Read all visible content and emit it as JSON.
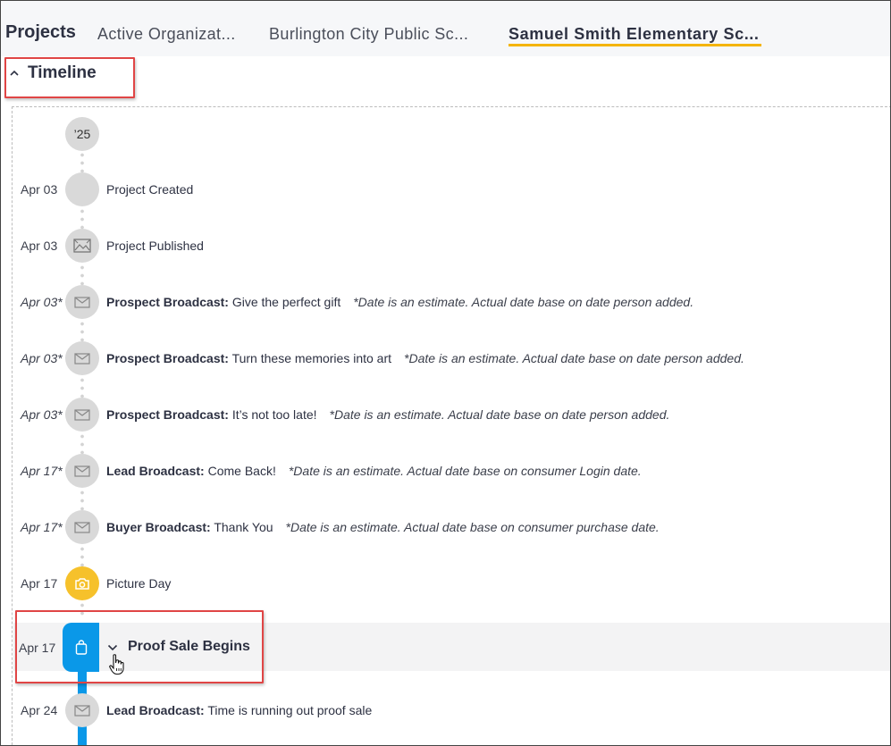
{
  "breadcrumb": {
    "root": "Projects",
    "items": [
      "Active Organizat...",
      "Burlington City Public Sc...",
      "Samuel Smith Elementary Sc..."
    ]
  },
  "section": {
    "title": "Timeline"
  },
  "timeline": {
    "year_label": "’25",
    "events": [
      {
        "date": "Apr 03",
        "kind": "",
        "text": "Project Created",
        "note": "",
        "icon": "blank"
      },
      {
        "date": "Apr 03",
        "kind": "",
        "text": "Project Published",
        "note": "",
        "icon": "image-icon"
      },
      {
        "date": "Apr 03*",
        "kind": "Prospect Broadcast:",
        "text": "Give the perfect gift",
        "note": "*Date is an estimate. Actual date base on date person added.",
        "icon": "envelope-icon"
      },
      {
        "date": "Apr 03*",
        "kind": "Prospect Broadcast:",
        "text": "Turn these memories into art",
        "note": "*Date is an estimate. Actual date base on date person added.",
        "icon": "envelope-icon"
      },
      {
        "date": "Apr 03*",
        "kind": "Prospect Broadcast:",
        "text": "It’s not too late!",
        "note": "*Date is an estimate. Actual date base on date person added.",
        "icon": "envelope-icon"
      },
      {
        "date": "Apr 17*",
        "kind": "Lead Broadcast:",
        "text": "Come Back!",
        "note": "*Date is an estimate. Actual date base on consumer Login date.",
        "icon": "envelope-icon"
      },
      {
        "date": "Apr 17*",
        "kind": "Buyer Broadcast:",
        "text": "Thank You",
        "note": "*Date is an estimate. Actual date base on consumer purchase date.",
        "icon": "envelope-icon"
      },
      {
        "date": "Apr 17",
        "kind": "",
        "text": "Picture Day",
        "note": "",
        "icon": "camera-icon"
      }
    ],
    "proof_sale": {
      "date": "Apr 17",
      "label": "Proof Sale Begins"
    },
    "after": [
      {
        "date": "Apr 24",
        "kind": "Lead Broadcast:",
        "text": "Time is running out proof sale",
        "note": "",
        "icon": "envelope-icon"
      }
    ]
  },
  "colors": {
    "accent_yellow": "#f4b400",
    "picture_day": "#f6c12b",
    "proof_blue": "#0a98e8",
    "annotation_red": "#e04545"
  }
}
